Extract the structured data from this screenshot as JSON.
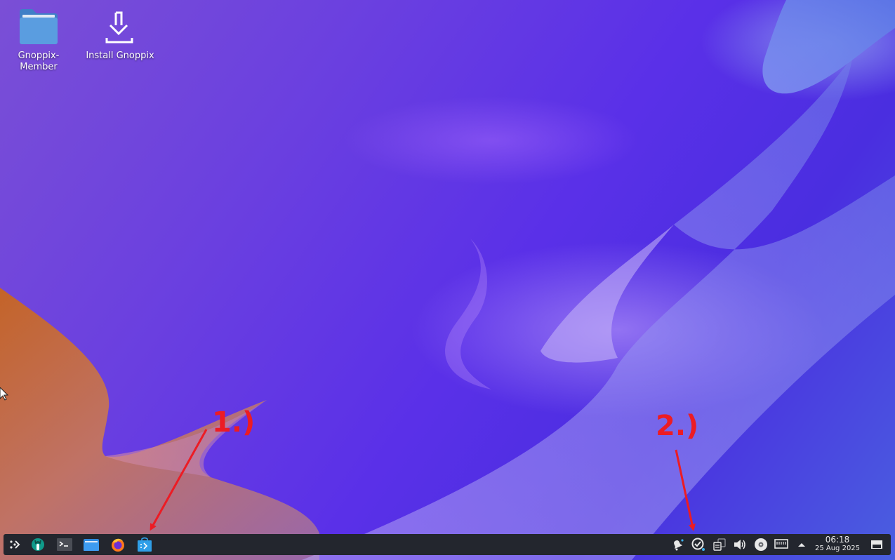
{
  "desktop": {
    "icons": [
      {
        "label": "Gnoppix-\nMember",
        "icon": "folder-icon"
      },
      {
        "label": "Install Gnoppix",
        "icon": "download-install-icon"
      }
    ]
  },
  "annotations": {
    "marker_1": "1.)",
    "marker_2": "2.)",
    "color": "#ec1c24"
  },
  "taskbar": {
    "launchers": [
      {
        "name": "application-launcher",
        "icon": "app-menu-icon"
      },
      {
        "name": "gnoppix-app",
        "icon": "gnoppix-logo-icon"
      },
      {
        "name": "terminal",
        "icon": "terminal-icon"
      },
      {
        "name": "file-manager",
        "icon": "folder-icon"
      },
      {
        "name": "firefox",
        "icon": "firefox-icon"
      },
      {
        "name": "software-store",
        "icon": "store-bag-icon"
      }
    ],
    "tray": [
      {
        "name": "notifications",
        "icon": "bell-icon"
      },
      {
        "name": "updates",
        "icon": "update-icon"
      },
      {
        "name": "clipboard",
        "icon": "clipboard-icon"
      },
      {
        "name": "volume",
        "icon": "speaker-icon"
      },
      {
        "name": "media-disc",
        "icon": "disc-icon"
      },
      {
        "name": "network",
        "icon": "ethernet-icon"
      },
      {
        "name": "show-hidden",
        "icon": "chevron-up-icon"
      }
    ],
    "clock": {
      "time": "06:18",
      "date": "25 Aug 2025"
    },
    "show_desktop": "show-desktop-icon"
  },
  "colors": {
    "taskbar_bg": "#23262e",
    "accent_blue": "#3d9bf0"
  }
}
